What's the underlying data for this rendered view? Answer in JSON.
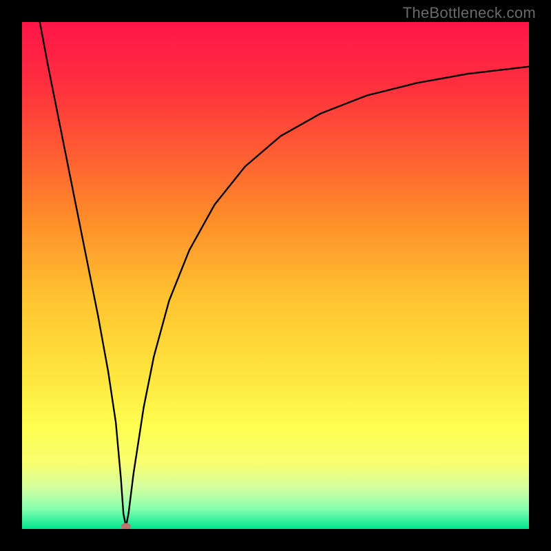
{
  "watermark": "TheBottleneck.com",
  "chart_data": {
    "type": "line",
    "title": "",
    "xlabel": "",
    "ylabel": "",
    "xlim": [
      0,
      100
    ],
    "ylim": [
      0,
      100
    ],
    "grid": false,
    "legend": false,
    "annotations": {
      "marker": {
        "x": 20.5,
        "y": 0.5,
        "color": "#b9766d",
        "label": ""
      }
    },
    "background_gradient": {
      "stops": [
        {
          "offset": 0.0,
          "color": "#ff1648"
        },
        {
          "offset": 0.12,
          "color": "#ff2e3f"
        },
        {
          "offset": 0.25,
          "color": "#ff5a33"
        },
        {
          "offset": 0.38,
          "color": "#ff8a2a"
        },
        {
          "offset": 0.55,
          "color": "#ffc531"
        },
        {
          "offset": 0.7,
          "color": "#ffe63e"
        },
        {
          "offset": 0.8,
          "color": "#ffff51"
        },
        {
          "offset": 0.87,
          "color": "#f9ff70"
        },
        {
          "offset": 0.92,
          "color": "#d2ffa0"
        },
        {
          "offset": 0.96,
          "color": "#87ffb0"
        },
        {
          "offset": 1.0,
          "color": "#00e58e"
        }
      ]
    },
    "series": [
      {
        "name": "bottleneck-curve",
        "color": "#000000",
        "x": [
          3.5,
          5,
          7,
          9,
          11,
          13,
          15,
          17,
          18.5,
          19.5,
          20,
          20.5,
          21,
          22,
          24,
          26,
          29,
          33,
          38,
          44,
          51,
          59,
          68,
          78,
          88,
          100
        ],
        "y": [
          100,
          92,
          82,
          72,
          62,
          52,
          42,
          31,
          21,
          10,
          3,
          0.5,
          3,
          11,
          24,
          34,
          45,
          55,
          64,
          71.5,
          77.5,
          82,
          85.5,
          88,
          89.8,
          91.2
        ]
      }
    ]
  }
}
